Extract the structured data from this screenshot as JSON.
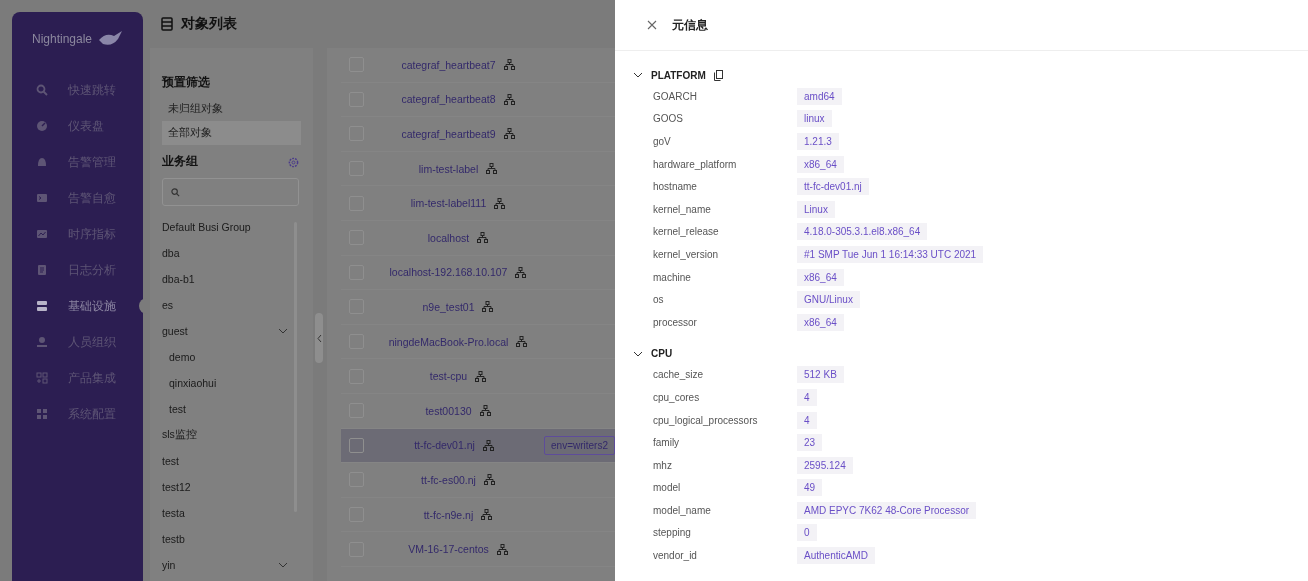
{
  "sidebar": {
    "logo": "Nightingale",
    "items": [
      {
        "label": "快速跳转",
        "selected": false
      },
      {
        "label": "仪表盘",
        "selected": false
      },
      {
        "label": "告警管理",
        "selected": false
      },
      {
        "label": "告警自愈",
        "selected": false
      },
      {
        "label": "时序指标",
        "selected": false
      },
      {
        "label": "日志分析",
        "selected": false
      },
      {
        "label": "基础设施",
        "selected": true
      },
      {
        "label": "人员组织",
        "selected": false
      },
      {
        "label": "产品集成",
        "selected": false
      },
      {
        "label": "系统配置",
        "selected": false
      }
    ]
  },
  "page_title": "对象列表",
  "filters": {
    "preset_title": "预置筛选",
    "presets": [
      {
        "label": "未归组对象",
        "selected": false
      },
      {
        "label": "全部对象",
        "selected": true
      }
    ],
    "groups_title": "业务组",
    "groups": [
      {
        "label": "Default Busi Group"
      },
      {
        "label": "dba"
      },
      {
        "label": "dba-b1"
      },
      {
        "label": "es"
      },
      {
        "label": "guest",
        "expanded": true,
        "children": [
          {
            "label": "demo"
          },
          {
            "label": "qinxiaohui"
          },
          {
            "label": "test"
          }
        ]
      },
      {
        "label": "sls监控"
      },
      {
        "label": "test"
      },
      {
        "label": "test12"
      },
      {
        "label": "testa"
      },
      {
        "label": "testb"
      },
      {
        "label": "yin",
        "expanded": true
      }
    ]
  },
  "table": {
    "rows": [
      {
        "name": "categraf_heartbeat7",
        "checked": false,
        "selected": false
      },
      {
        "name": "categraf_heartbeat8",
        "checked": false,
        "selected": false
      },
      {
        "name": "categraf_heartbeat9",
        "checked": false,
        "selected": false
      },
      {
        "name": "lim-test-label",
        "checked": false,
        "selected": false
      },
      {
        "name": "lim-test-label111",
        "checked": false,
        "selected": false
      },
      {
        "name": "localhost",
        "checked": false,
        "selected": false
      },
      {
        "name": "localhost-192.168.10.107",
        "checked": false,
        "selected": false
      },
      {
        "name": "n9e_test01",
        "checked": false,
        "selected": false
      },
      {
        "name": "ningdeMacBook-Pro.local",
        "checked": false,
        "selected": false
      },
      {
        "name": "test-cpu",
        "checked": false,
        "selected": false
      },
      {
        "name": "test00130",
        "checked": false,
        "selected": false
      },
      {
        "name": "tt-fc-dev01.nj",
        "checked": false,
        "selected": true,
        "tags": [
          "env=writers2"
        ]
      },
      {
        "name": "tt-fc-es00.nj",
        "checked": false,
        "selected": false
      },
      {
        "name": "tt-fc-n9e.nj",
        "checked": false,
        "selected": false
      },
      {
        "name": "VM-16-17-centos",
        "checked": false,
        "selected": false
      }
    ]
  },
  "drawer": {
    "title": "元信息",
    "sections": [
      {
        "title": "PLATFORM",
        "expanded": true,
        "copyable": true,
        "rows": [
          {
            "key": "GOARCH",
            "value": "amd64"
          },
          {
            "key": "GOOS",
            "value": "linux"
          },
          {
            "key": "goV",
            "value": "1.21.3"
          },
          {
            "key": "hardware_platform",
            "value": "x86_64"
          },
          {
            "key": "hostname",
            "value": "tt-fc-dev01.nj"
          },
          {
            "key": "kernel_name",
            "value": "Linux"
          },
          {
            "key": "kernel_release",
            "value": "4.18.0-305.3.1.el8.x86_64"
          },
          {
            "key": "kernel_version",
            "value": "#1 SMP Tue Jun 1 16:14:33 UTC 2021"
          },
          {
            "key": "machine",
            "value": "x86_64"
          },
          {
            "key": "os",
            "value": "GNU/Linux"
          },
          {
            "key": "processor",
            "value": "x86_64"
          }
        ]
      },
      {
        "title": "CPU",
        "expanded": true,
        "copyable": false,
        "rows": [
          {
            "key": "cache_size",
            "value": "512 KB"
          },
          {
            "key": "cpu_cores",
            "value": "4"
          },
          {
            "key": "cpu_logical_processors",
            "value": "4"
          },
          {
            "key": "family",
            "value": "23"
          },
          {
            "key": "mhz",
            "value": "2595.124"
          },
          {
            "key": "model",
            "value": "49"
          },
          {
            "key": "model_name",
            "value": "AMD EPYC 7K62 48-Core Processor"
          },
          {
            "key": "stepping",
            "value": "0"
          },
          {
            "key": "vendor_id",
            "value": "AuthenticAMD"
          }
        ]
      }
    ]
  }
}
